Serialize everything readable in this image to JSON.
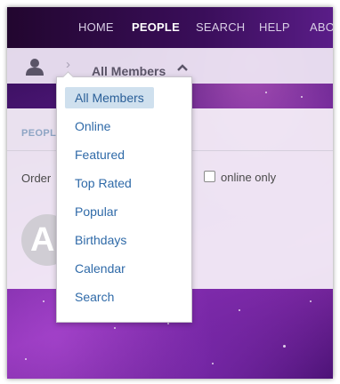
{
  "topnav": {
    "items": [
      {
        "label": "HOME",
        "active": false
      },
      {
        "label": "PEOPLE",
        "active": true
      },
      {
        "label": "SEARCH",
        "active": false
      },
      {
        "label": "HELP",
        "active": false
      },
      {
        "label": "ABO",
        "active": false
      }
    ]
  },
  "breadcrumb": {
    "icon": "user-icon",
    "separator": "›",
    "current": "All Members",
    "caret": "chevron-up-icon"
  },
  "panel": {
    "section_title": "PEOPL",
    "order_label": "Order",
    "online_only_label": "online only",
    "online_only_checked": false,
    "avatar_letter": "A"
  },
  "dropdown": {
    "selected": "All Members",
    "options": [
      "All Members",
      "Online",
      "Featured",
      "Top Rated",
      "Popular",
      "Birthdays",
      "Calendar",
      "Search"
    ]
  },
  "colors": {
    "link": "#2f6aa8",
    "selected_bg": "#cfe0ee",
    "nav_bg": "#2b0a45"
  }
}
